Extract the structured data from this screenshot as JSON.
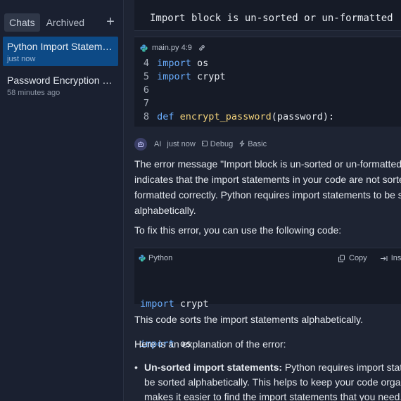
{
  "sidebar": {
    "tabs": [
      {
        "label": "Chats",
        "active": true
      },
      {
        "label": "Archived",
        "active": false
      }
    ],
    "new_chat_icon": "plus-icon",
    "chats": [
      {
        "title": "Python Import Statemen...",
        "time": "just now",
        "selected": true
      },
      {
        "title": "Password Encryption usi...",
        "time": "58 minutes ago",
        "selected": false
      }
    ]
  },
  "main": {
    "selection_text": "Import block is un-sorted or un-formatted",
    "file_block": {
      "file_ref": "main.py 4:9",
      "lines": [
        {
          "num": "4",
          "kw": "import",
          "rest": " os"
        },
        {
          "num": "5",
          "kw": "import",
          "rest": " crypt"
        },
        {
          "num": "6",
          "kw": "",
          "rest": ""
        },
        {
          "num": "7",
          "kw": "",
          "rest": ""
        },
        {
          "num": "8",
          "kw": "def",
          "fn": "encrypt_password",
          "rest": "(password):"
        }
      ]
    },
    "message": {
      "author": "AI",
      "time": "just now",
      "debug_label": "Debug",
      "basic_label": "Basic",
      "para1_lines": [
        "The error message \"Import block is un-sorted or un-formatted\"",
        "indicates that the import statements in your code are not sorted or",
        "formatted correctly. Python requires import statements to be sorted",
        "alphabetically."
      ],
      "para2": "To fix this error, you can use the following code:",
      "code_block": {
        "language": "Python",
        "copy_label": "Copy",
        "insert_label": "Ins",
        "lines": [
          {
            "kw": "import",
            "rest": " crypt"
          },
          {
            "kw": "import",
            "rest": " os"
          }
        ]
      },
      "para3": "This code sorts the import statements alphabetically.",
      "para4": "Here is an explanation of the error:",
      "bullet1": {
        "bold": "Un-sorted import statements:",
        "line1_rest": " Python requires import statement",
        "line2": "be sorted alphabetically. This helps to keep your code organized a",
        "line3": "makes it easier to find the import statements that you need."
      }
    }
  },
  "colors": {
    "sidebar_bg": "#1a2030",
    "main_bg": "#1e2433",
    "selected_chat": "#0d4a86",
    "keyword": "#6aaeff",
    "function": "#f2d27a"
  }
}
